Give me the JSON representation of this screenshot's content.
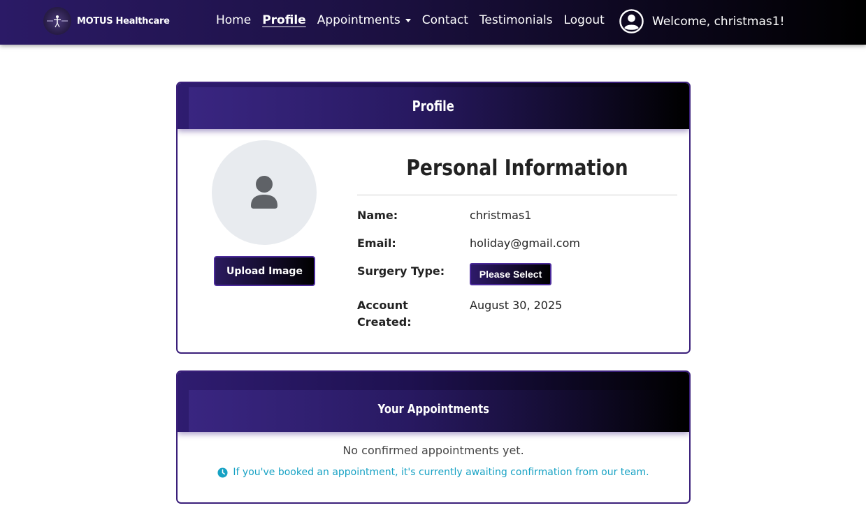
{
  "brand": {
    "name": "MOTUS Healthcare",
    "logo_icon": "medical-figure-icon"
  },
  "nav": {
    "items": [
      {
        "label": "Home",
        "active": false
      },
      {
        "label": "Profile",
        "active": true
      },
      {
        "label": "Appointments",
        "active": false,
        "dropdown": true
      },
      {
        "label": "Contact",
        "active": false
      },
      {
        "label": "Testimonials",
        "active": false
      },
      {
        "label": "Logout",
        "active": false
      }
    ],
    "user_icon": "user-circle-icon",
    "welcome_text": "Welcome, christmas1!"
  },
  "profile_card": {
    "header_title": "Profile",
    "avatar_icon": "user-silhouette-icon",
    "upload_button_label": "Upload Image",
    "section_title": "Personal Information",
    "fields": {
      "name_label": "Name:",
      "name_value": "christmas1",
      "email_label": "Email:",
      "email_value": "holiday@gmail.com",
      "surgery_label": "Surgery Type:",
      "surgery_select_label": "Please Select",
      "account_created_label": "Account Created:",
      "account_created_value": "August 30, 2025"
    }
  },
  "appointments_card": {
    "header_title": "Your Appointments",
    "empty_message": "No confirmed appointments yet.",
    "pending_icon": "clock-icon",
    "pending_message": "If you've booked an appointment, it's currently awaiting confirmation from our team."
  },
  "colors": {
    "primary_dark": "#2b1a66",
    "accent_border": "#3a1f7a",
    "info_text": "#17a2c4"
  }
}
